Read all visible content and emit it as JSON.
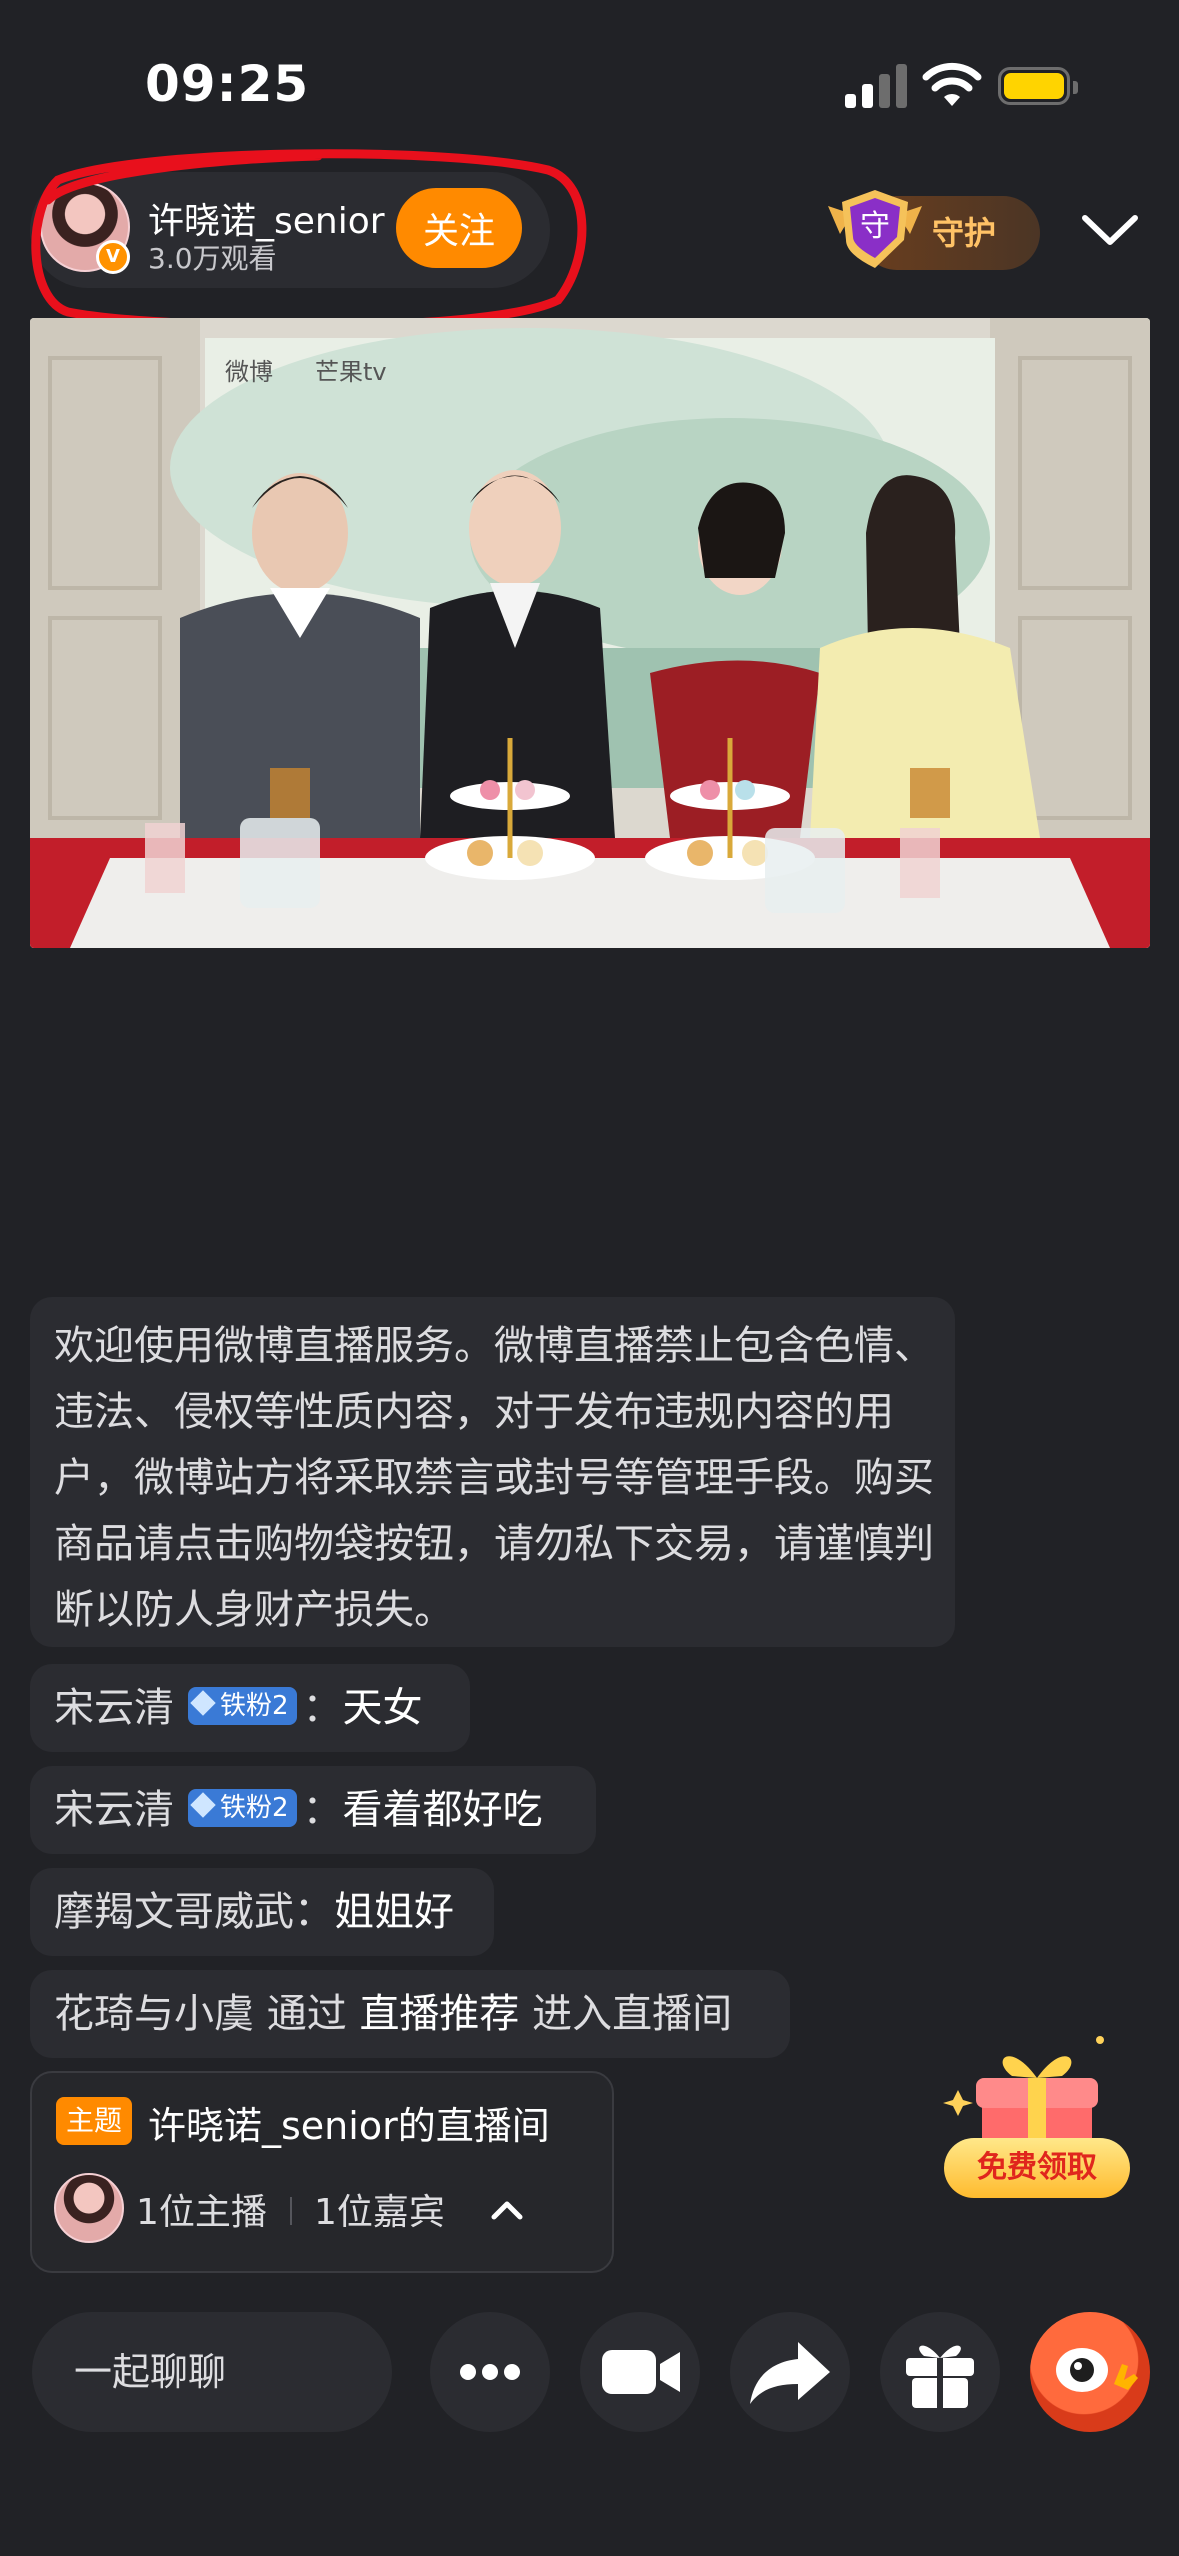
{
  "status_bar": {
    "time": "09:25"
  },
  "host": {
    "name": "许晓诺_senior",
    "viewers": "3.0万观看",
    "verified_badge": "V",
    "follow_label": "关注",
    "guard_label": "守护",
    "guard_shield_glyph": "守"
  },
  "video": {
    "watermark_left": "微博",
    "watermark_right": "芒果tv"
  },
  "notice": {
    "text": "欢迎使用微博直播服务。微博直播禁止包含色情、违法、侵权等性质内容，对于发布违规内容的用户，微博站方将采取禁言或封号等管理手段。购买商品请点击购物袋按钮，请勿私下交易，请谨慎判断以防人身财产损失。"
  },
  "chat": [
    {
      "user": "宋云清",
      "badge": "铁粉2",
      "sep": "：",
      "message": "天女"
    },
    {
      "user": "宋云清",
      "badge": "铁粉2",
      "sep": "：",
      "message": "看着都好吃"
    },
    {
      "user": "摩羯文哥威武",
      "sep": "：",
      "message": "姐姐好"
    },
    {
      "user": "花琦与小虞",
      "via": "通过",
      "source": "直播推荐",
      "action": "进入直播间"
    }
  ],
  "room": {
    "tag": "主题",
    "title": "许晓诺_senior的直播间",
    "hosts": "1位主播",
    "guests": "1位嘉宾"
  },
  "gift_promo": {
    "label": "免费领取"
  },
  "toolbar": {
    "chat_placeholder": "一起聊聊",
    "icons": [
      "more-icon",
      "camera-icon",
      "share-icon",
      "gift-icon",
      "weibo-mascot-icon"
    ]
  },
  "colors": {
    "background": "#212226",
    "panel": "#2b2c31",
    "accent": "#ff8a00",
    "fan_badge": "#3a7ad6",
    "annotation": "#e8101c"
  }
}
